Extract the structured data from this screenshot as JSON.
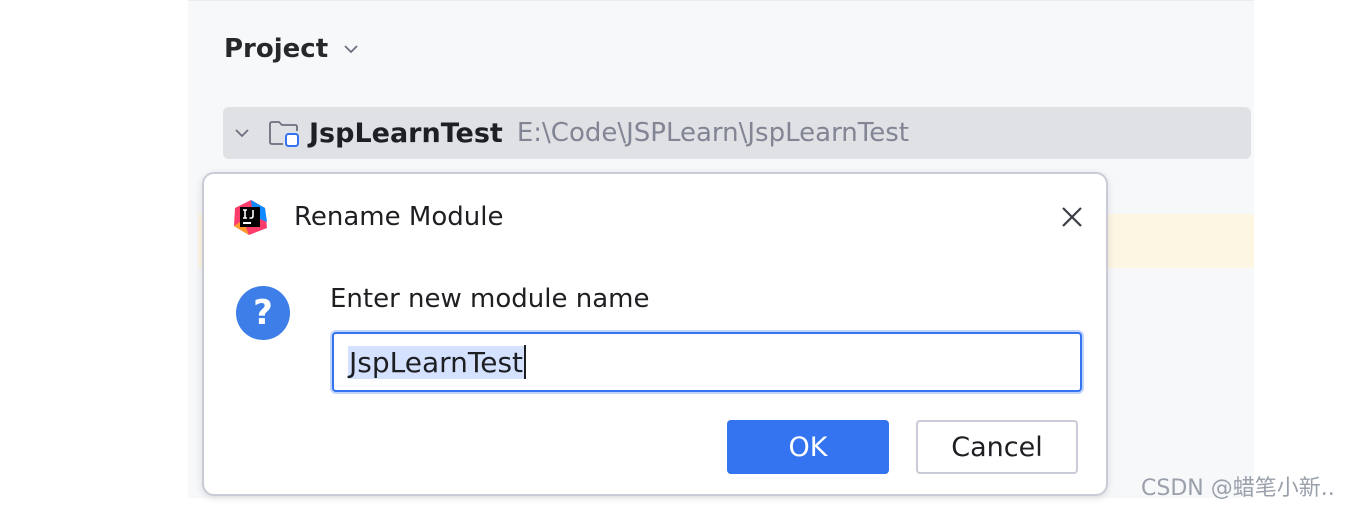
{
  "project_panel": {
    "title": "Project",
    "tree": {
      "project_name": "JspLearnTest",
      "project_path": "E:\\Code\\JSPLearn\\JspLearnTest"
    }
  },
  "dialog": {
    "title": "Rename Module",
    "prompt": "Enter new module name",
    "input_value": "JspLearnTest",
    "ok_label": "OK",
    "cancel_label": "Cancel"
  },
  "colors": {
    "accent": "#3574f0",
    "question_icon": "#3d7ee8",
    "selection_row": "#dfe1e5"
  },
  "icons": {
    "app_logo": "intellij-idea-logo-icon",
    "close": "close-icon",
    "question": "question-icon",
    "folder": "module-folder-icon",
    "chevron": "chevron-down-icon"
  },
  "watermark": "CSDN @蜡笔小新.."
}
